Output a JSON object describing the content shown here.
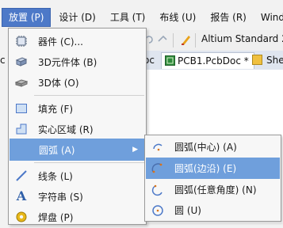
{
  "menubar": {
    "items": [
      "放置 (P)",
      "设计 (D)",
      "工具 (T)",
      "布线 (U)",
      "报告 (R)",
      "Windo"
    ]
  },
  "toolbar": {
    "app_title": "Altium Standard 2"
  },
  "tabs": {
    "left_fragment": "c",
    "pcb_tab": "PCB1.PcbDoc *",
    "prev_fragment": "oc",
    "sheet_fragment": "Shee"
  },
  "place_menu": {
    "items": [
      {
        "label": "器件 (C)...",
        "icon": "component-icon"
      },
      {
        "label": "3D元件体 (B)",
        "icon": "3d-body-icon"
      },
      {
        "label": "3D体 (O)",
        "icon": "3d-solid-icon"
      },
      {
        "label": "填充 (F)",
        "icon": "fill-icon"
      },
      {
        "label": "实心区域 (R)",
        "icon": "solid-region-icon"
      },
      {
        "label": "圆弧 (A)",
        "icon": "arc-icon"
      },
      {
        "label": "线条 (L)",
        "icon": "line-icon"
      },
      {
        "label": "字符串 (S)",
        "icon": "string-icon"
      },
      {
        "label": "焊盘 (P)",
        "icon": "pad-icon"
      }
    ]
  },
  "arc_submenu": {
    "items": [
      {
        "label": "圆弧(中心) (A)",
        "icon": "arc-center-icon"
      },
      {
        "label": "圆弧(边沿) (E)",
        "icon": "arc-edge-icon"
      },
      {
        "label": "圆弧(任意角度) (N)",
        "icon": "arc-any-angle-icon"
      },
      {
        "label": "圆 (U)",
        "icon": "full-circle-icon"
      }
    ]
  },
  "colors": {
    "menu_highlight": "#6f9fdc",
    "menubar_active": "#4d79c8",
    "menu_background": "#f7f7f7"
  }
}
